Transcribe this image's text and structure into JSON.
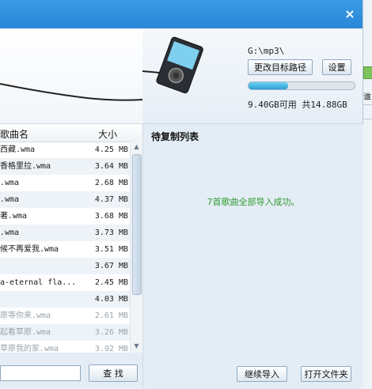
{
  "window": {
    "close_symbol": "×"
  },
  "device": {
    "path": "G:\\mp3\\",
    "change_path_label": "更改目标路径",
    "settings_label": "设置",
    "storage_fraction": 0.37,
    "storage_text": "9.40GB可用 共14.88GB"
  },
  "list": {
    "header_name": "歌曲名",
    "header_size": "大小",
    "rows": [
      {
        "name": "西藏.wma",
        "size": "4.25 MB"
      },
      {
        "name": "香格里拉.wma",
        "size": "3.64 MB"
      },
      {
        "name": ".wma",
        "size": "2.68 MB"
      },
      {
        "name": ".wma",
        "size": "4.37 MB"
      },
      {
        "name": "著.wma",
        "size": "3.68 MB"
      },
      {
        "name": ".wma",
        "size": "3.73 MB"
      },
      {
        "name": "候不再爱我.wma",
        "size": "3.51 MB"
      },
      {
        "name": "",
        "size": "3.67 MB"
      },
      {
        "name": "a-eternal fla...",
        "size": "2.45 MB"
      },
      {
        "name": "",
        "size": "4.03 MB"
      },
      {
        "name": "原等你来.wma",
        "size": "2.61 MB"
      },
      {
        "name": "起看草原.wma",
        "size": "3.26 MB"
      },
      {
        "name": "草原我的家.wma",
        "size": "3.92 MB"
      }
    ]
  },
  "search": {
    "value": "",
    "button_label": "查 找"
  },
  "pending": {
    "title": "待复制列表",
    "message": "7首歌曲全部导入成功。",
    "continue_label": "继续导入",
    "open_folder_label": "打开文件夹"
  },
  "side": {
    "fragment": "谁"
  },
  "colors": {
    "titlebar": "#2a86d6",
    "success": "#2f9a2f"
  }
}
